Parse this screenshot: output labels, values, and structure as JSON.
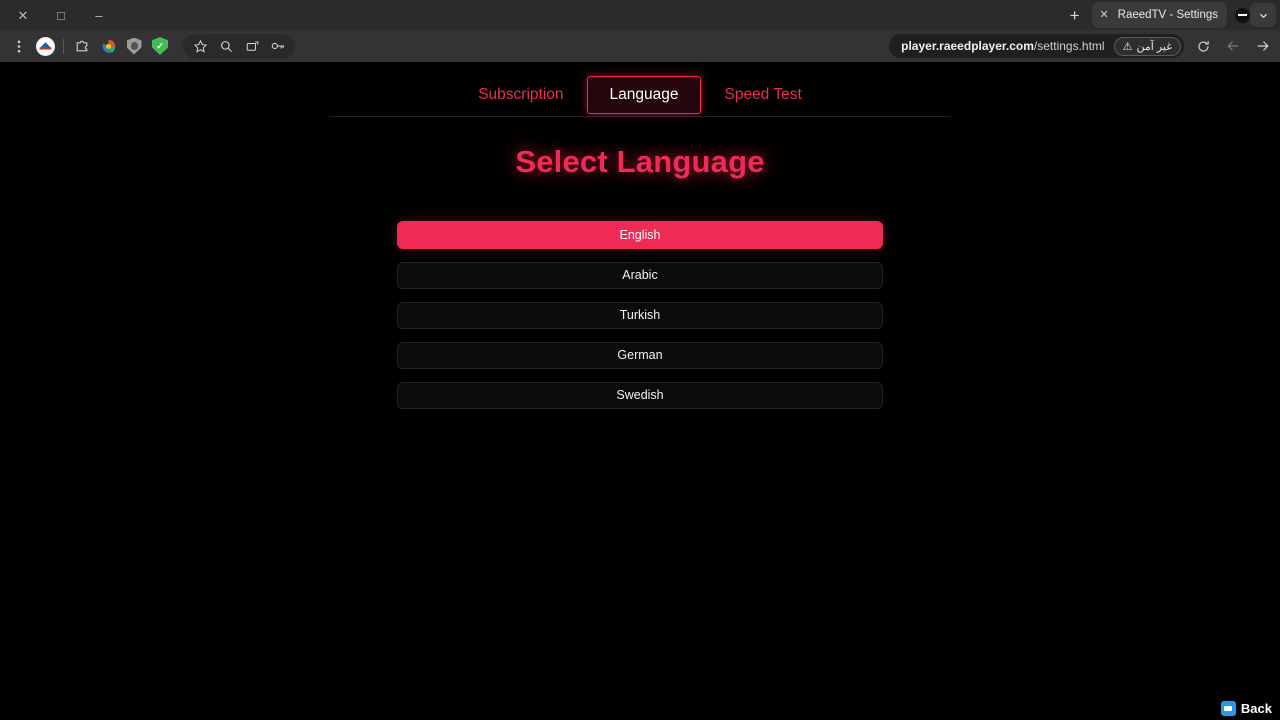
{
  "browser": {
    "window_controls": [
      {
        "name": "close",
        "glyph": "✕"
      },
      {
        "name": "maximize",
        "glyph": "□"
      },
      {
        "name": "minimize",
        "glyph": "–"
      }
    ],
    "new_tab_label": "+",
    "tab": {
      "close_label": "✕",
      "title": "RaeedTV - Settings"
    },
    "tab_list_chevron": "⌄",
    "toolbar_icons": [
      "menu-dots-icon",
      "profile-logo-icon",
      "extensions-puzzle-icon",
      "downloads-color-icon",
      "shield-grey-icon",
      "shield-green-check-icon",
      "bookmark-star-icon",
      "search-magnifier-icon",
      "screenshot-capture-icon",
      "password-key-icon"
    ],
    "shield_green_glyph": "✓",
    "url": {
      "host": "player.raeedplayer.com",
      "path": "/settings.html"
    },
    "security_badge": {
      "label": "غير آمن",
      "icon_glyph": "⚠"
    },
    "nav": {
      "reload_glyph": "↻",
      "back_glyph": "←",
      "forward_glyph": "→"
    }
  },
  "page": {
    "tabs": [
      {
        "label": "Subscription",
        "active": false
      },
      {
        "label": "Language",
        "active": true
      },
      {
        "label": "Speed Test",
        "active": false
      }
    ],
    "title": "Select Language",
    "languages": [
      {
        "label": "English",
        "selected": true
      },
      {
        "label": "Arabic",
        "selected": false
      },
      {
        "label": "Turkish",
        "selected": false
      },
      {
        "label": "German",
        "selected": false
      },
      {
        "label": "Swedish",
        "selected": false
      }
    ],
    "back": {
      "label": "Back"
    },
    "colors": {
      "accent": "#ef2a55",
      "background": "#000000",
      "button_bg": "#0c0c0c",
      "back_icon": "#1e9bf0"
    }
  }
}
